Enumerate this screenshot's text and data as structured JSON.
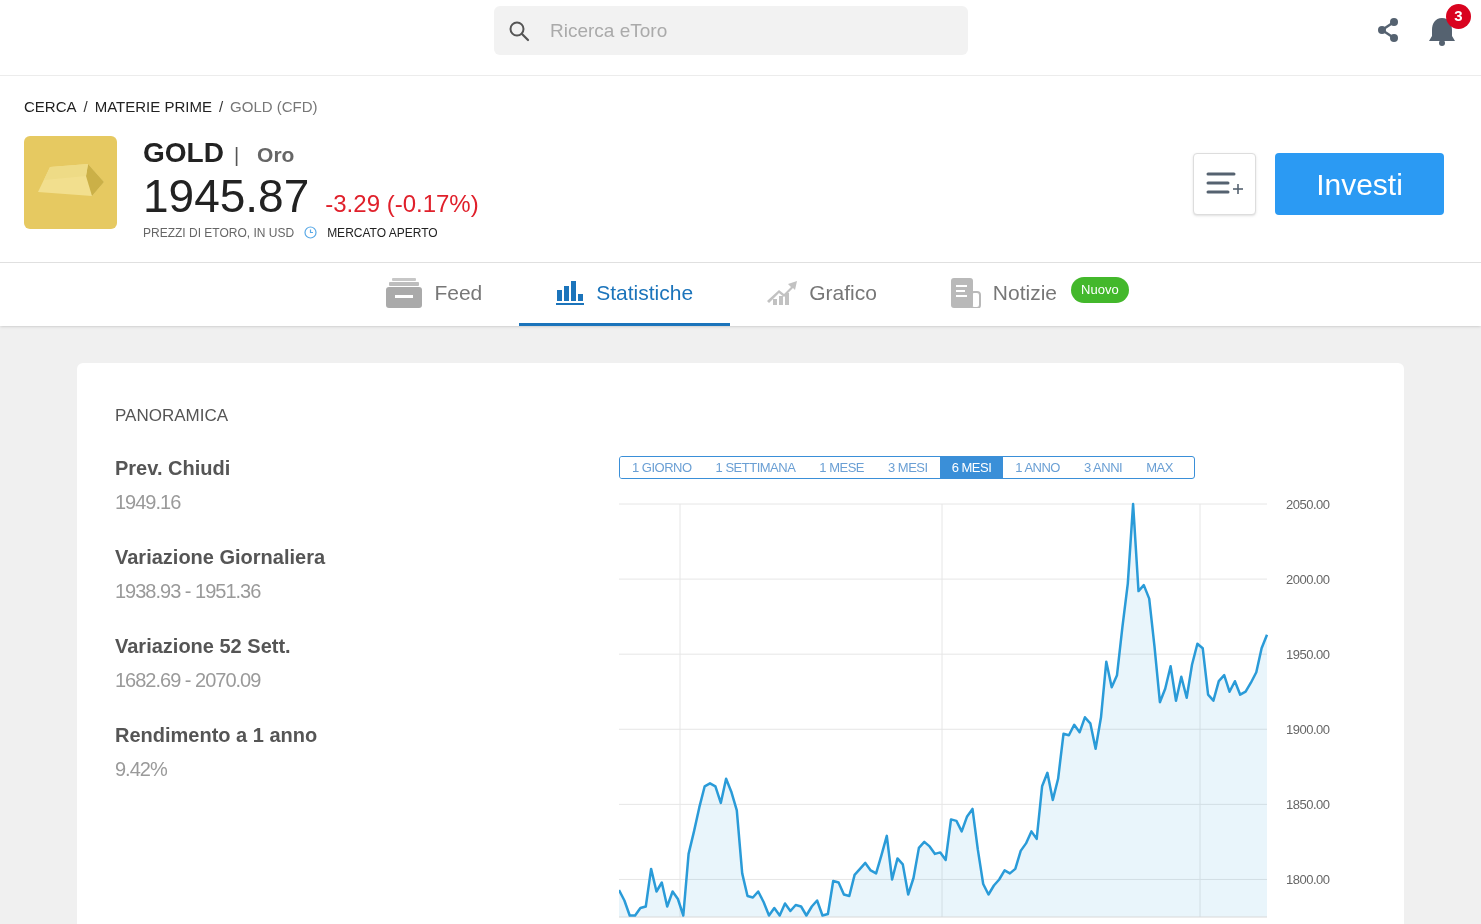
{
  "header": {
    "search": {
      "placeholder": "Ricerca eToro"
    },
    "notifications": {
      "count": "3"
    }
  },
  "breadcrumb": {
    "separator": "/",
    "items": [
      {
        "label": "CERCA",
        "current": false
      },
      {
        "label": "MATERIE PRIME",
        "current": false
      },
      {
        "label": "GOLD (CFD)",
        "current": true
      }
    ]
  },
  "instrument": {
    "symbol": "GOLD",
    "separator": "|",
    "name": "Oro",
    "price": "1945.87",
    "change": "-3.29 (-0.17%)",
    "price_note": "PREZZI DI ETORO, IN USD",
    "market_status": "MERCATO APERTO"
  },
  "actions": {
    "invest_button": "Investi"
  },
  "tabs": [
    {
      "label": "Feed",
      "kind": "feed",
      "selected": false
    },
    {
      "label": "Statistiche",
      "kind": "stats",
      "selected": true
    },
    {
      "label": "Grafico",
      "kind": "chart",
      "selected": false
    },
    {
      "label": "Notizie",
      "kind": "news",
      "selected": false,
      "badge": "Nuovo"
    }
  ],
  "overview": {
    "title": "PANORAMICA",
    "stats": [
      {
        "label": "Prev. Chiudi",
        "value": "1949.16"
      },
      {
        "label": "Variazione Giornaliera",
        "value": "1938.93 - 1951.36"
      },
      {
        "label": "Variazione 52 Sett.",
        "value": "1682.69 - 2070.09"
      },
      {
        "label": "Rendimento a 1 anno",
        "value": "9.42%"
      }
    ]
  },
  "chart": {
    "ranges": [
      {
        "label": "1 GIORNO",
        "selected": false
      },
      {
        "label": "1 SETTIMANA",
        "selected": false
      },
      {
        "label": "1 MESE",
        "selected": false
      },
      {
        "label": "3 MESI",
        "selected": false
      },
      {
        "label": "6 MESI",
        "selected": true
      },
      {
        "label": "1 ANNO",
        "selected": false
      },
      {
        "label": "3 ANNI",
        "selected": false
      },
      {
        "label": "MAX",
        "selected": false
      }
    ],
    "chart_data": {
      "type": "area",
      "grid": true,
      "ylim": [
        1775,
        2050
      ],
      "yticks": [
        {
          "value": 1800,
          "label": "1800.00"
        },
        {
          "value": 1850,
          "label": "1850.00"
        },
        {
          "value": 1900,
          "label": "1900.00"
        },
        {
          "value": 1950,
          "label": "1950.00"
        },
        {
          "value": 2000,
          "label": "2000.00"
        },
        {
          "value": 2050,
          "label": "2050.00"
        }
      ],
      "series": [
        {
          "color": "#2a9bd8",
          "values": [
            1793,
            1786,
            1776,
            1776,
            1781,
            1782,
            1807,
            1792,
            1798,
            1782,
            1792,
            1787,
            1776,
            1817,
            1832,
            1848,
            1862,
            1864,
            1862,
            1851,
            1867,
            1858,
            1846,
            1804,
            1789,
            1788,
            1792,
            1785,
            1776,
            1781,
            1776,
            1784,
            1779,
            1783,
            1782,
            1776,
            1782,
            1786,
            1776,
            1777,
            1799,
            1798,
            1790,
            1789,
            1803,
            1807,
            1811,
            1806,
            1804,
            1816,
            1829,
            1800,
            1814,
            1810,
            1790,
            1801,
            1821,
            1825,
            1822,
            1817,
            1818,
            1813,
            1840,
            1839,
            1832,
            1842,
            1847,
            1820,
            1797,
            1790,
            1796,
            1800,
            1806,
            1804,
            1807,
            1819,
            1824,
            1832,
            1827,
            1862,
            1871,
            1853,
            1867,
            1897,
            1896,
            1903,
            1898,
            1908,
            1904,
            1887,
            1908,
            1945,
            1928,
            1936,
            1968,
            1997,
            2050,
            1992,
            1996,
            1987,
            1955,
            1918,
            1927,
            1942,
            1919,
            1935,
            1921,
            1943,
            1957,
            1954,
            1923,
            1919,
            1932,
            1936,
            1925,
            1932,
            1923,
            1925,
            1931,
            1938,
            1954,
            1963
          ]
        }
      ]
    }
  }
}
